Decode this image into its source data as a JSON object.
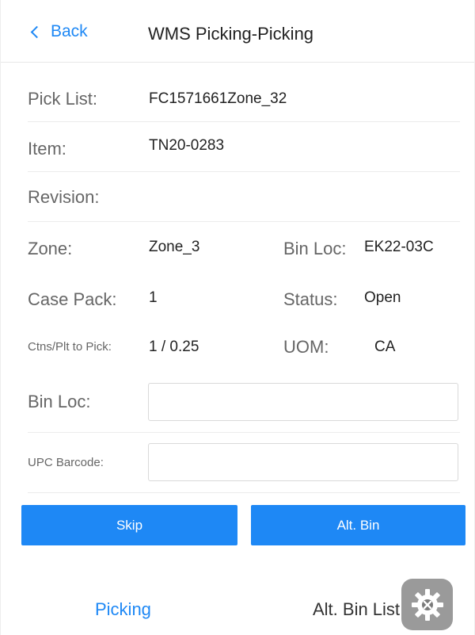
{
  "header": {
    "back_label": "Back",
    "title": "WMS Picking-Picking"
  },
  "fields": {
    "pick_list": {
      "label": "Pick List:",
      "value": "FC1571661Zone_32"
    },
    "item": {
      "label": "Item:",
      "value": "TN20-0283"
    },
    "revision": {
      "label": "Revision:",
      "value": ""
    },
    "zone": {
      "label": "Zone:",
      "value": "Zone_3"
    },
    "bin_loc_info": {
      "label": "Bin Loc:",
      "value": "EK22-03C"
    },
    "case_pack": {
      "label": "Case Pack:",
      "value": "1"
    },
    "status": {
      "label": "Status:",
      "value": "Open"
    },
    "ctns_plt": {
      "label": "Ctns/Plt to Pick:",
      "value": "1 / 0.25"
    },
    "uom": {
      "label": "UOM:",
      "value": "CA"
    }
  },
  "inputs": {
    "bin_loc": {
      "label": "Bin Loc:",
      "value": "",
      "placeholder": ""
    },
    "upc_barcode": {
      "label": "UPC Barcode:",
      "value": "",
      "placeholder": ""
    }
  },
  "buttons": {
    "skip": "Skip",
    "alt_bin": "Alt. Bin"
  },
  "footer": {
    "picking": "Picking",
    "alt_bin_list": "Alt. Bin List"
  },
  "colors": {
    "accent": "#1e88f5",
    "label": "#666666",
    "text": "#222222"
  },
  "icons": {
    "back": "chevron-left-icon",
    "settings": "gear-icon"
  }
}
